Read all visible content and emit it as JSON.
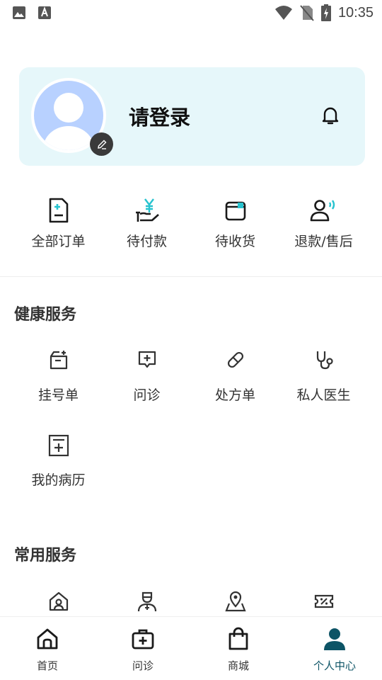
{
  "status_bar": {
    "time": "10:35"
  },
  "profile": {
    "login_label": "请登录"
  },
  "orders": [
    {
      "label": "全部订单",
      "icon": "order-document-icon"
    },
    {
      "label": "待付款",
      "icon": "payment-yen-icon"
    },
    {
      "label": "待收货",
      "icon": "package-box-icon"
    },
    {
      "label": "退款/售后",
      "icon": "after-sales-person-icon"
    }
  ],
  "health": {
    "title": "健康服务",
    "items": [
      {
        "label": "挂号单",
        "icon": "registration-icon"
      },
      {
        "label": "问诊",
        "icon": "consultation-icon"
      },
      {
        "label": "处方单",
        "icon": "pill-icon"
      },
      {
        "label": "私人医生",
        "icon": "stethoscope-icon"
      },
      {
        "label": "我的病历",
        "icon": "medical-record-icon"
      }
    ]
  },
  "common": {
    "title": "常用服务",
    "items": [
      {
        "icon": "address-home-icon"
      },
      {
        "icon": "doctor-icon"
      },
      {
        "icon": "location-icon"
      },
      {
        "icon": "coupon-icon"
      }
    ]
  },
  "tabs": [
    {
      "label": "首页",
      "icon": "home-icon"
    },
    {
      "label": "问诊",
      "icon": "medical-kit-icon"
    },
    {
      "label": "商城",
      "icon": "shopping-bag-icon"
    },
    {
      "label": "个人中心",
      "icon": "person-icon"
    }
  ],
  "colors": {
    "card_bg": "#e6f7fa",
    "avatar": "#b8d1ff",
    "accent": "#0d5466",
    "teal": "#27c3cf"
  }
}
